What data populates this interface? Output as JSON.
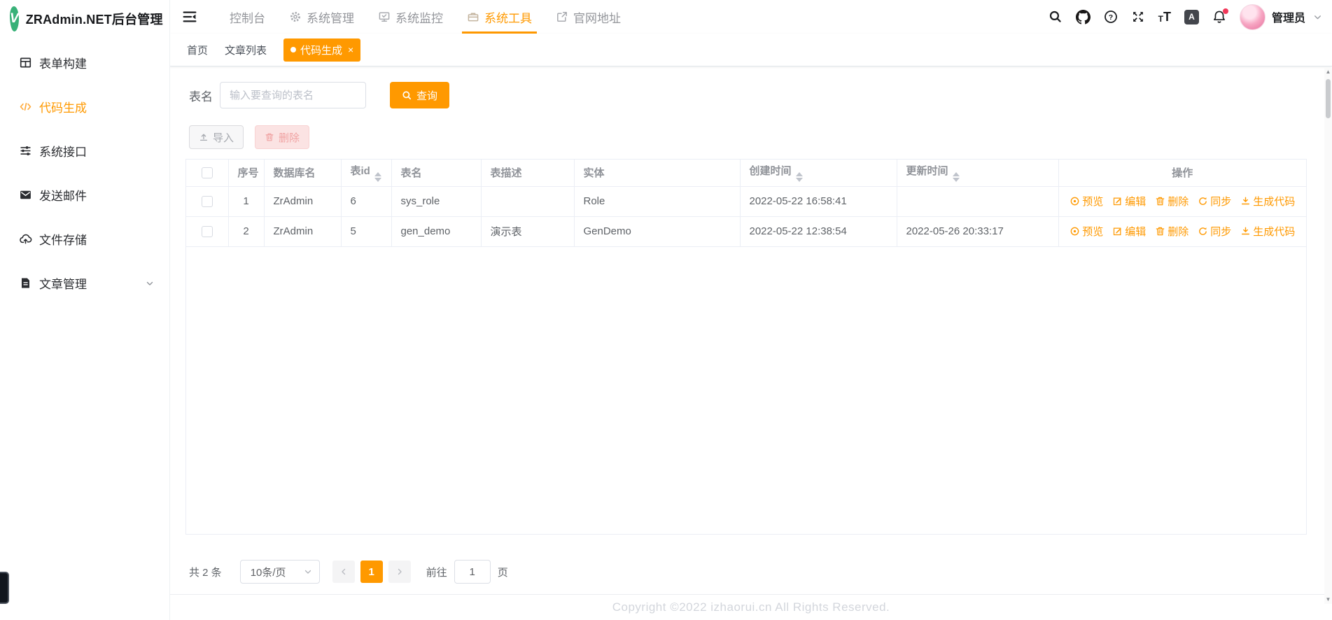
{
  "app": {
    "title": "ZRAdmin.NET后台管理",
    "logo_letter": "V"
  },
  "topnav": {
    "items": [
      {
        "label": "控制台",
        "icon": ""
      },
      {
        "label": "系统管理",
        "icon": "gear-icon"
      },
      {
        "label": "系统监控",
        "icon": "monitor-icon"
      },
      {
        "label": "系统工具",
        "icon": "toolbox-icon",
        "active": true
      },
      {
        "label": "官网地址",
        "icon": "external-link-icon"
      }
    ],
    "user": {
      "name": "管理员"
    }
  },
  "sidebar": {
    "items": [
      {
        "label": "表单构建",
        "icon": "form-grid-icon"
      },
      {
        "label": "代码生成",
        "icon": "code-icon",
        "active": true
      },
      {
        "label": "系统接口",
        "icon": "sliders-icon"
      },
      {
        "label": "发送邮件",
        "icon": "mail-icon"
      },
      {
        "label": "文件存储",
        "icon": "cloud-upload-icon"
      },
      {
        "label": "文章管理",
        "icon": "document-icon",
        "has_submenu": true
      }
    ]
  },
  "tabs": [
    {
      "label": "首页"
    },
    {
      "label": "文章列表"
    },
    {
      "label": "代码生成",
      "active": true,
      "closable": true,
      "close_glyph": "×"
    }
  ],
  "query": {
    "label": "表名",
    "placeholder": "输入要查询的表名",
    "search_label": "查询"
  },
  "toolbar": {
    "import_label": "导入",
    "delete_label": "删除"
  },
  "table": {
    "columns": [
      {
        "label": "序号"
      },
      {
        "label": "数据库名"
      },
      {
        "label": "表id",
        "sortable": true
      },
      {
        "label": "表名"
      },
      {
        "label": "表描述"
      },
      {
        "label": "实体"
      },
      {
        "label": "创建时间",
        "sortable": true
      },
      {
        "label": "更新时间",
        "sortable": true
      },
      {
        "label": "操作"
      }
    ],
    "rows": [
      {
        "seq": "1",
        "db": "ZrAdmin",
        "table_id": "6",
        "name": "sys_role",
        "desc": "",
        "entity": "Role",
        "created": "2022-05-22 16:58:41",
        "updated": ""
      },
      {
        "seq": "2",
        "db": "ZrAdmin",
        "table_id": "5",
        "name": "gen_demo",
        "desc": "演示表",
        "entity": "GenDemo",
        "created": "2022-05-22 12:38:54",
        "updated": "2022-05-26 20:33:17"
      }
    ],
    "row_actions": [
      {
        "label": "预览",
        "icon": "eye-icon"
      },
      {
        "label": "编辑",
        "icon": "edit-icon"
      },
      {
        "label": "删除",
        "icon": "trash-icon"
      },
      {
        "label": "同步",
        "icon": "sync-icon"
      },
      {
        "label": "生成代码",
        "icon": "download-icon"
      }
    ]
  },
  "pagination": {
    "total_text": "共 2 条",
    "page_size": "10条/页",
    "current_page": "1",
    "goto_label": "前往",
    "goto_value": "1",
    "page_unit": "页"
  },
  "footer": {
    "copyright": "Copyright ©2022 izhaorui.cn All Rights Reserved."
  },
  "colors": {
    "accent": "#ff9900",
    "danger": "#f2385a",
    "table_border": "#ebeef5"
  }
}
